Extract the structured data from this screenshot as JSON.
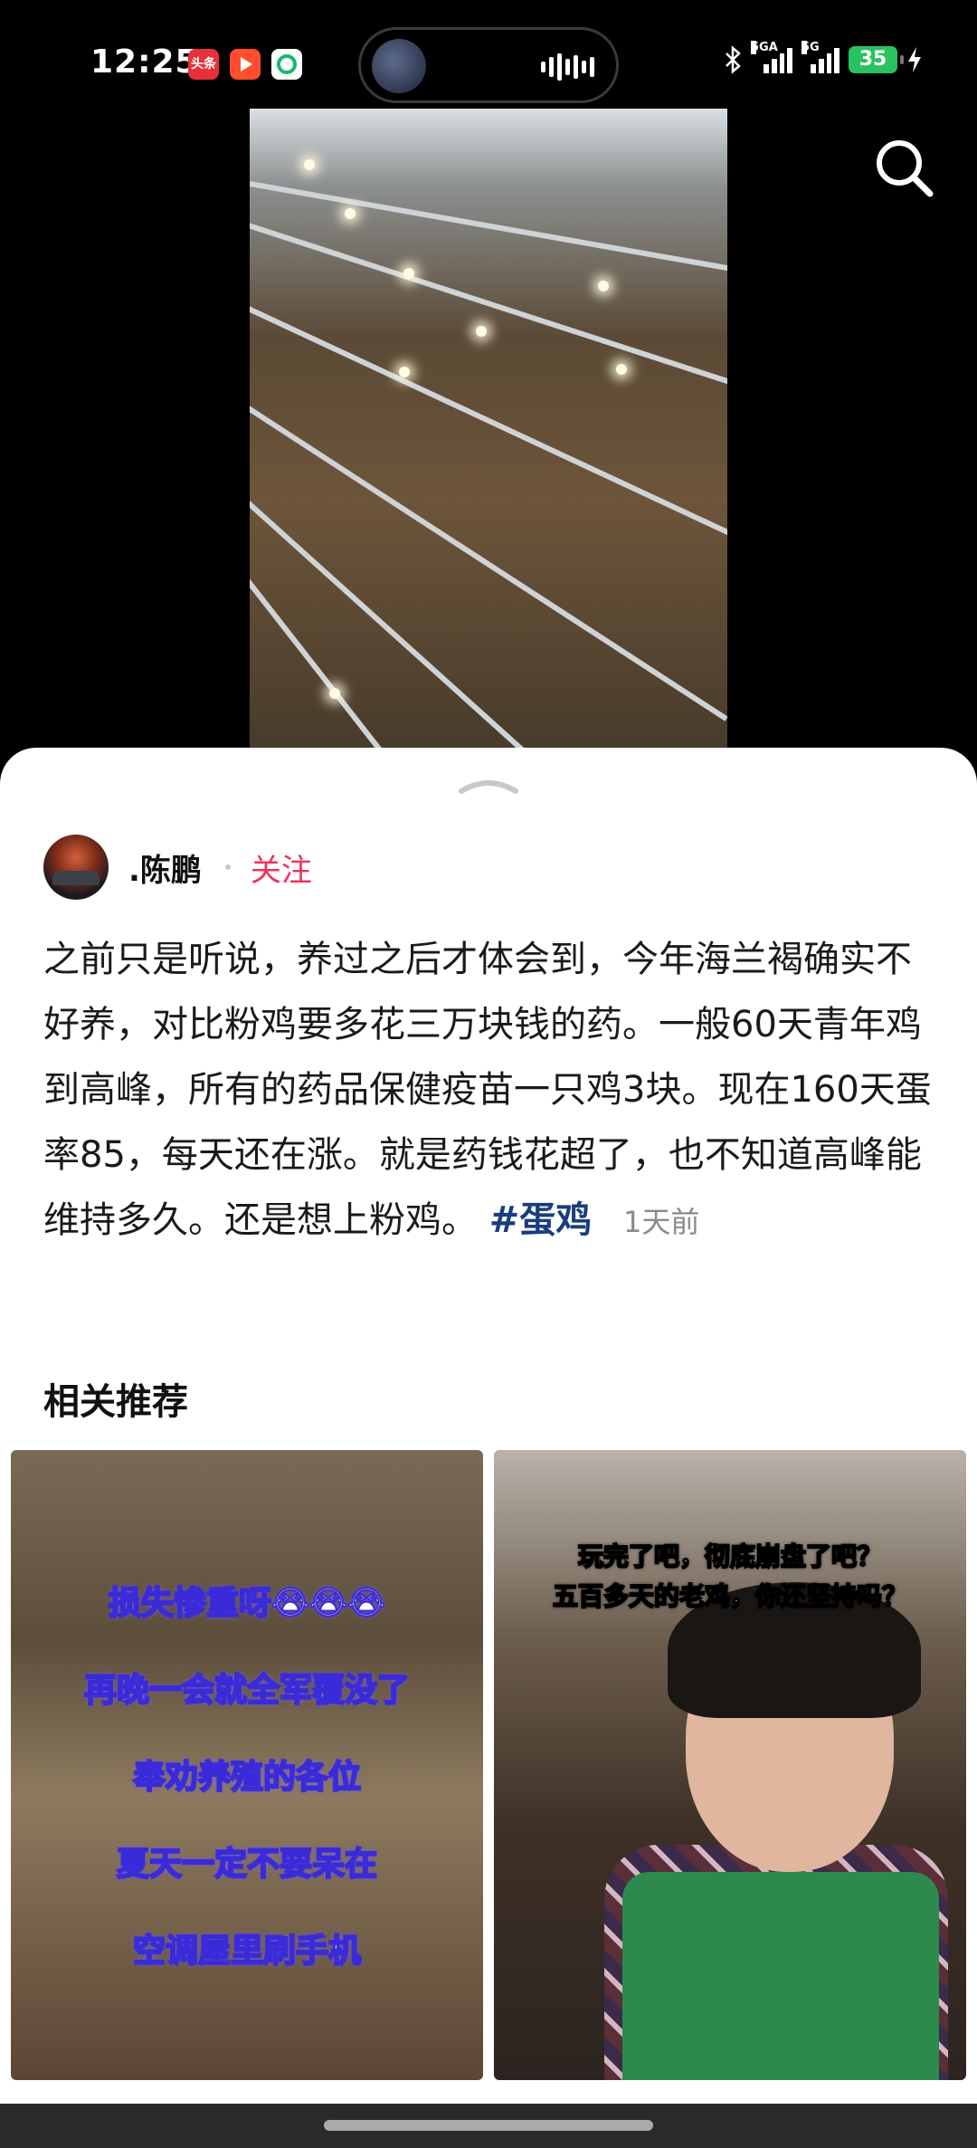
{
  "status_bar": {
    "time": "12:25",
    "toutiao_label": "头条",
    "network_1": "5GA",
    "network_2": "5G",
    "battery": "35"
  },
  "post": {
    "author_name": ".陈鹏",
    "follow_label": "关注",
    "text": "之前只是听说，养过之后才体会到，今年海兰褐确实不好养，对比粉鸡要多花三万块钱的药。一般60天青年鸡到高峰，所有的药品保健疫苗一只鸡3块。现在160天蛋率85，每天还在涨。就是药钱花超了，也不知道高峰能维持多久。还是想上粉鸡。",
    "hashtag": "#蛋鸡",
    "time_ago": "1天前"
  },
  "related": {
    "title": "相关推荐",
    "card_1_lines": [
      "损失惨重呀😭😭😭",
      "再晚一会就全军覆没了",
      "奉劝养殖的各位",
      "夏天一定不要呆在",
      "空调屋里刷手机"
    ],
    "card_2_lines": [
      "玩完了吧，彻底崩盘了吧？",
      "五百多天的老鸡，你还坚持吗？"
    ]
  },
  "colors": {
    "follow": "#f0325a",
    "hashtag": "#1a3d7c",
    "battery": "#29c260"
  },
  "icons": [
    "search-icon",
    "chevron-up-icon",
    "bluetooth-icon",
    "signal-icon",
    "battery-icon",
    "charging-icon"
  ]
}
